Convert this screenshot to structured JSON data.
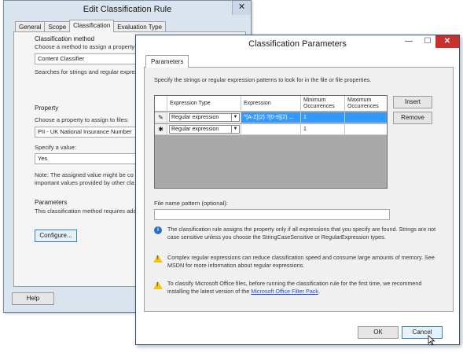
{
  "back_window": {
    "title": "Edit Classification Rule",
    "close_glyph": "✕",
    "tabs": [
      "General",
      "Scope",
      "Classification",
      "Evaluation Type"
    ],
    "classification_method": {
      "heading": "Classification method",
      "prompt": "Choose a method to assign a property t",
      "selected": "Content Classifier",
      "description": "Searches for strings and regular expres"
    },
    "property": {
      "heading": "Property",
      "prompt": "Choose a property to assign to files:",
      "selected": "PII - UK National Insurance Number",
      "value_prompt": "Specify a value:",
      "value": "Yes",
      "note_line1": "Note: The assigned value might be co",
      "note_line2": "important values provided by other cla"
    },
    "parameters": {
      "heading": "Parameters",
      "description": "This classification method requires add",
      "configure_label": "Configure..."
    },
    "help_label": "Help"
  },
  "dialog": {
    "title": "Classification Parameters",
    "window_glyphs": {
      "minimize": "—",
      "maximize": "☐",
      "close": "✕"
    },
    "tab": "Parameters",
    "instructions": "Specify the strings or regular expression patterns to look for in the file or file properties.",
    "grid": {
      "headers": [
        "Expression Type",
        "Expression",
        "Minimum Occurrences",
        "Maximum Occurrences"
      ],
      "rows": [
        {
          "marker": "✎",
          "type": "Regular expression",
          "expression": "^[A-Z]{2} ?[0-9]{2} ...",
          "min": "1",
          "max": "",
          "selected": true
        },
        {
          "marker": "✱",
          "type": "Regular expression",
          "expression": "",
          "min": "1",
          "max": "",
          "selected": false
        }
      ]
    },
    "insert_label": "Insert",
    "remove_label": "Remove",
    "file_pattern_label": "File name pattern (optional):",
    "file_pattern_value": "",
    "info_text": "The classification rule assigns the property only if all expressions that you specify are found. Strings are not case sensitive unless you choose the StringCaseSensitive or RegularExpression types.",
    "warning1_text": "Complex regular expressions can reduce classification speed and consume large amounts of memory. See MSDN for more information about regular expressions.",
    "warning2_text": "To classify Microsoft Office files, before running the classification rule for the first time, we recommend installing the latest version of the",
    "warning2_link": "Microsoft Office Filter Pack",
    "warning2_end": ".",
    "ok_label": "OK",
    "cancel_label": "Cancel"
  }
}
